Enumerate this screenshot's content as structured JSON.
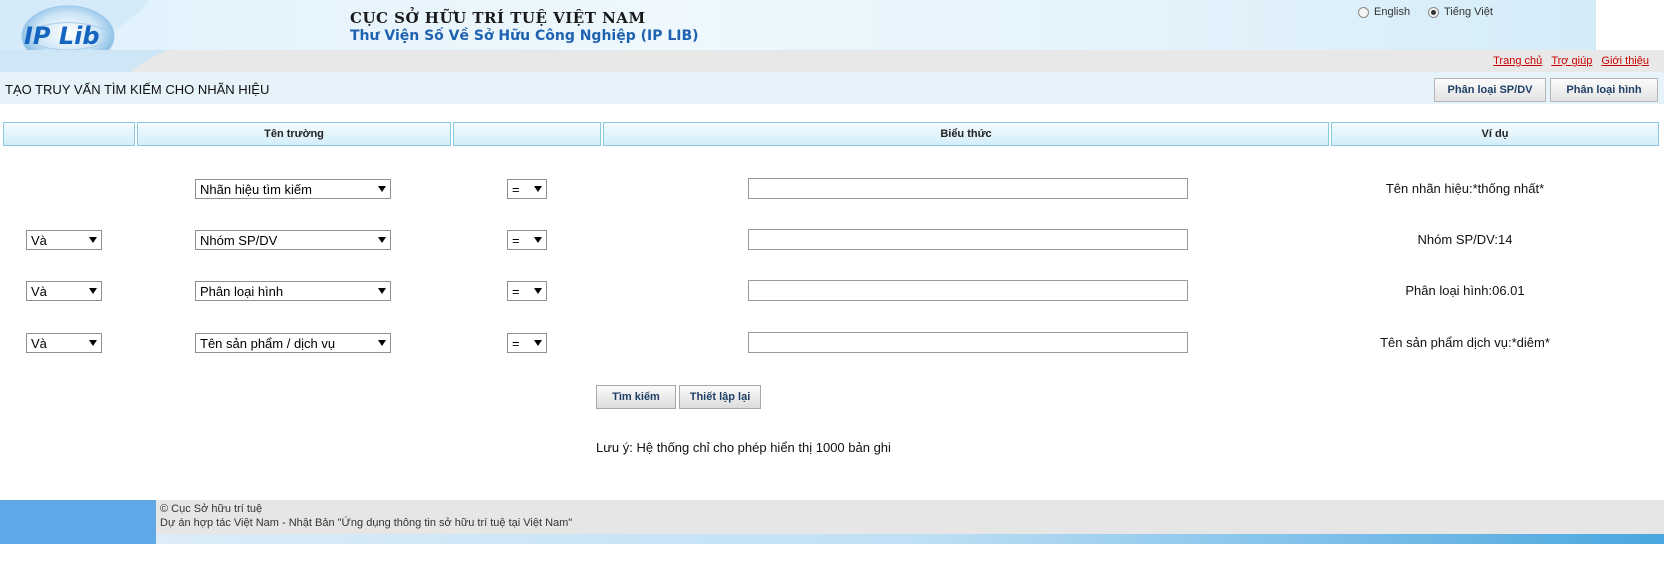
{
  "header": {
    "logo_text": "IP Lib",
    "title": "CỤC SỞ HỮU TRÍ TUỆ VIỆT NAM",
    "subtitle": "Thư Viện Số Về Sở Hữu Công Nghiệp (IP LIB)",
    "languages": [
      {
        "label": "English",
        "selected": false
      },
      {
        "label": "Tiếng Việt",
        "selected": true
      }
    ],
    "links": [
      "Trang chủ",
      "Trợ giúp",
      "Giới thiệu"
    ]
  },
  "page": {
    "title": "TẠO TRUY VẤN TÌM KIẾM CHO NHÃN HIỆU",
    "buttons": [
      "Phân loại SP/DV",
      "Phân loại hình"
    ]
  },
  "table": {
    "headers": [
      "",
      "Tên trường",
      "",
      "Biểu thức",
      "Ví dụ"
    ],
    "rows": [
      {
        "logic": "",
        "field": "Nhãn hiệu tìm kiếm",
        "operator": "=",
        "expression": "",
        "example": "Tên nhãn hiệu:*thống nhất*"
      },
      {
        "logic": "Và",
        "field": "Nhóm SP/DV",
        "operator": "=",
        "expression": "",
        "example": "Nhóm SP/DV:14"
      },
      {
        "logic": "Và",
        "field": "Phân loại hình",
        "operator": "=",
        "expression": "",
        "example": "Phân loại hình:06.01"
      },
      {
        "logic": "Và",
        "field": "Tên sản phẩm / dịch vụ",
        "operator": "=",
        "expression": "",
        "example": "Tên sản phẩm dịch vụ:*diêm*"
      }
    ]
  },
  "actions": {
    "search": "Tìm kiếm",
    "reset": "Thiết lập lại"
  },
  "note": "Lưu ý: Hệ thống chỉ cho phép hiển thị 1000 bản ghi",
  "footer": {
    "line1": "© Cục Sở hữu trí tuệ",
    "line2": "Dự án hợp tác Việt Nam - Nhật Bản \"Ứng dụng thông tin sở hữu trí tuệ tại Việt Nam\""
  },
  "colors": {
    "accent_blue": "#1e62b0",
    "link_red": "#cc0000",
    "header_cell_border": "#8cc7e3"
  }
}
